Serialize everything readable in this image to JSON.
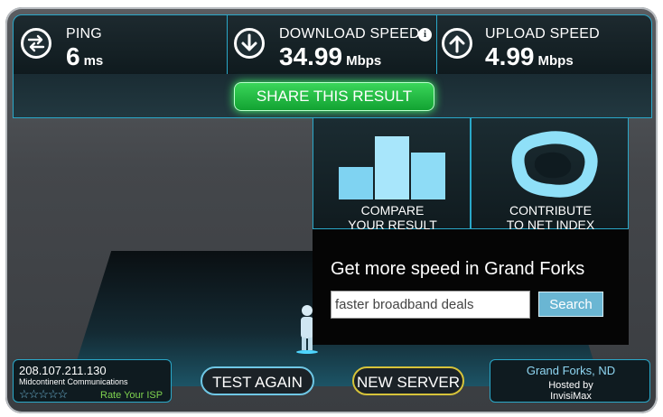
{
  "results": {
    "ping": {
      "label": "PING",
      "value": "6",
      "unit": "ms"
    },
    "download": {
      "label": "DOWNLOAD SPEED",
      "value": "34.99",
      "unit": "Mbps",
      "info": "i"
    },
    "upload": {
      "label": "UPLOAD SPEED",
      "value": "4.99",
      "unit": "Mbps"
    }
  },
  "share_label": "SHARE THIS RESULT",
  "ad": {
    "tiles": [
      {
        "line1": "COMPARE",
        "line2": "YOUR RESULT",
        "icon": "bar-chart-icon"
      },
      {
        "line1": "CONTRIBUTE",
        "line2": "TO NET INDEX",
        "icon": "net-index-icon"
      }
    ],
    "title": "Get more speed in Grand Forks",
    "input_value": "faster broadband deals",
    "search_label": "Search"
  },
  "isp": {
    "ip": "208.107.211.130",
    "name": "Midcontinent Communications",
    "rate_label": "Rate Your ISP",
    "stars": 5
  },
  "buttons": {
    "test_again": "TEST AGAIN",
    "new_server": "NEW SERVER"
  },
  "server": {
    "location": "Grand Forks, ND",
    "hosted_by": "Hosted by",
    "host": "InvisiMax"
  },
  "colors": {
    "accent": "#2aa8c9",
    "share_green": "#2fd14f",
    "new_server_border": "#d6c33a"
  }
}
